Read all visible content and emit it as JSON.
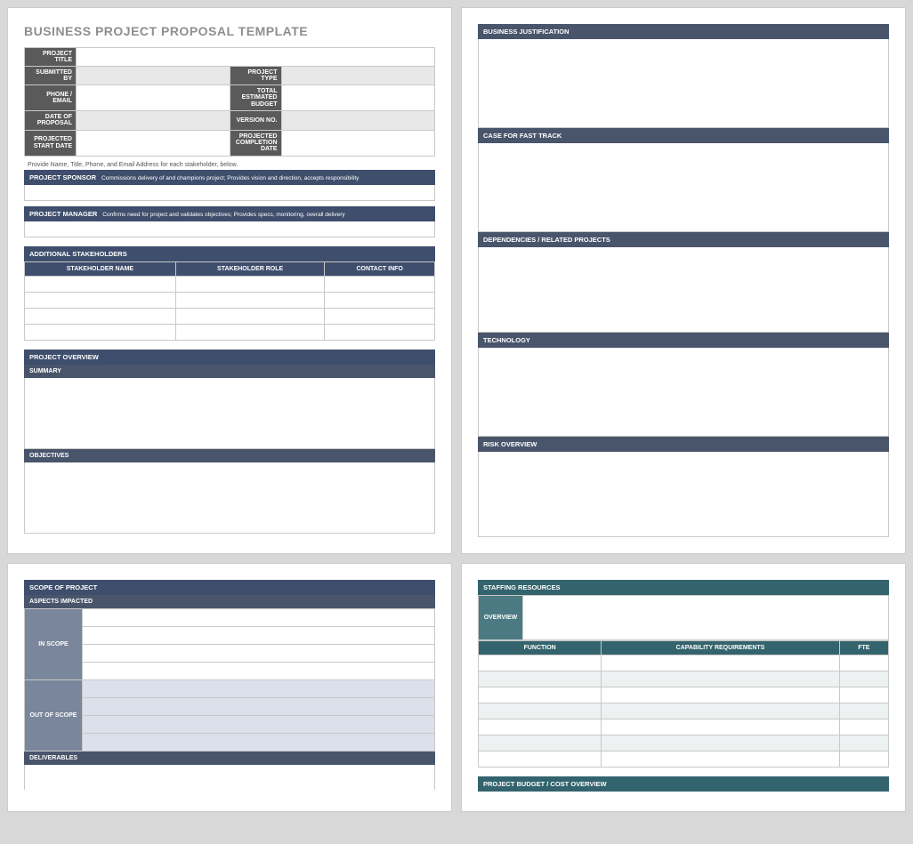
{
  "title": "BUSINESS PROJECT PROPOSAL TEMPLATE",
  "id_table": {
    "project_title_lbl": "PROJECT TITLE",
    "submitted_by_lbl": "SUBMITTED BY",
    "project_type_lbl": "PROJECT TYPE",
    "phone_email_lbl": "PHONE / EMAIL",
    "total_budget_lbl_l1": "TOTAL",
    "total_budget_lbl_l2": "ESTIMATED BUDGET",
    "date_of_proposal_lbl_l1": "DATE OF",
    "date_of_proposal_lbl_l2": "PROPOSAL",
    "version_no_lbl": "VERSION NO.",
    "projected_start_lbl_l1": "PROJECTED",
    "projected_start_lbl_l2": "START DATE",
    "projected_completion_lbl_l1": "PROJECTED",
    "projected_completion_lbl_l2": "COMPLETION DATE"
  },
  "stakeholder_note": "Provide Name, Title, Phone, and Email Address for each stakeholder, below.",
  "sponsor": {
    "label": "PROJECT SPONSOR",
    "desc": "Commissions delivery of and champions project; Provides vision and direction, accepts responsibility"
  },
  "manager": {
    "label": "PROJECT MANAGER",
    "desc": "Confirms need for project and validates objectives; Provides specs, monitoring, overall delivery"
  },
  "additional_stakeholders_header": "ADDITIONAL STAKEHOLDERS",
  "stakeholder_cols": {
    "name": "STAKEHOLDER NAME",
    "role": "STAKEHOLDER ROLE",
    "contact": "CONTACT INFO"
  },
  "overview": {
    "header": "PROJECT OVERVIEW",
    "summary": "SUMMARY",
    "objectives": "OBJECTIVES"
  },
  "right_panel_headers": {
    "justification": "BUSINESS JUSTIFICATION",
    "fast_track": "CASE FOR FAST TRACK",
    "dependencies": "DEPENDENCIES / RELATED PROJECTS",
    "technology": "TECHNOLOGY",
    "risk": "RISK OVERVIEW"
  },
  "scope": {
    "header": "SCOPE OF PROJECT",
    "aspects": "ASPECTS IMPACTED",
    "in_scope": "IN SCOPE",
    "out_of_scope": "OUT OF SCOPE",
    "deliverables": "DELIVERABLES"
  },
  "staffing": {
    "header": "STAFFING RESOURCES",
    "overview": "OVERVIEW",
    "cols": {
      "function": "FUNCTION",
      "capability": "CAPABILITY REQUIREMENTS",
      "fte": "FTE"
    },
    "budget_header": "PROJECT BUDGET / COST OVERVIEW"
  }
}
